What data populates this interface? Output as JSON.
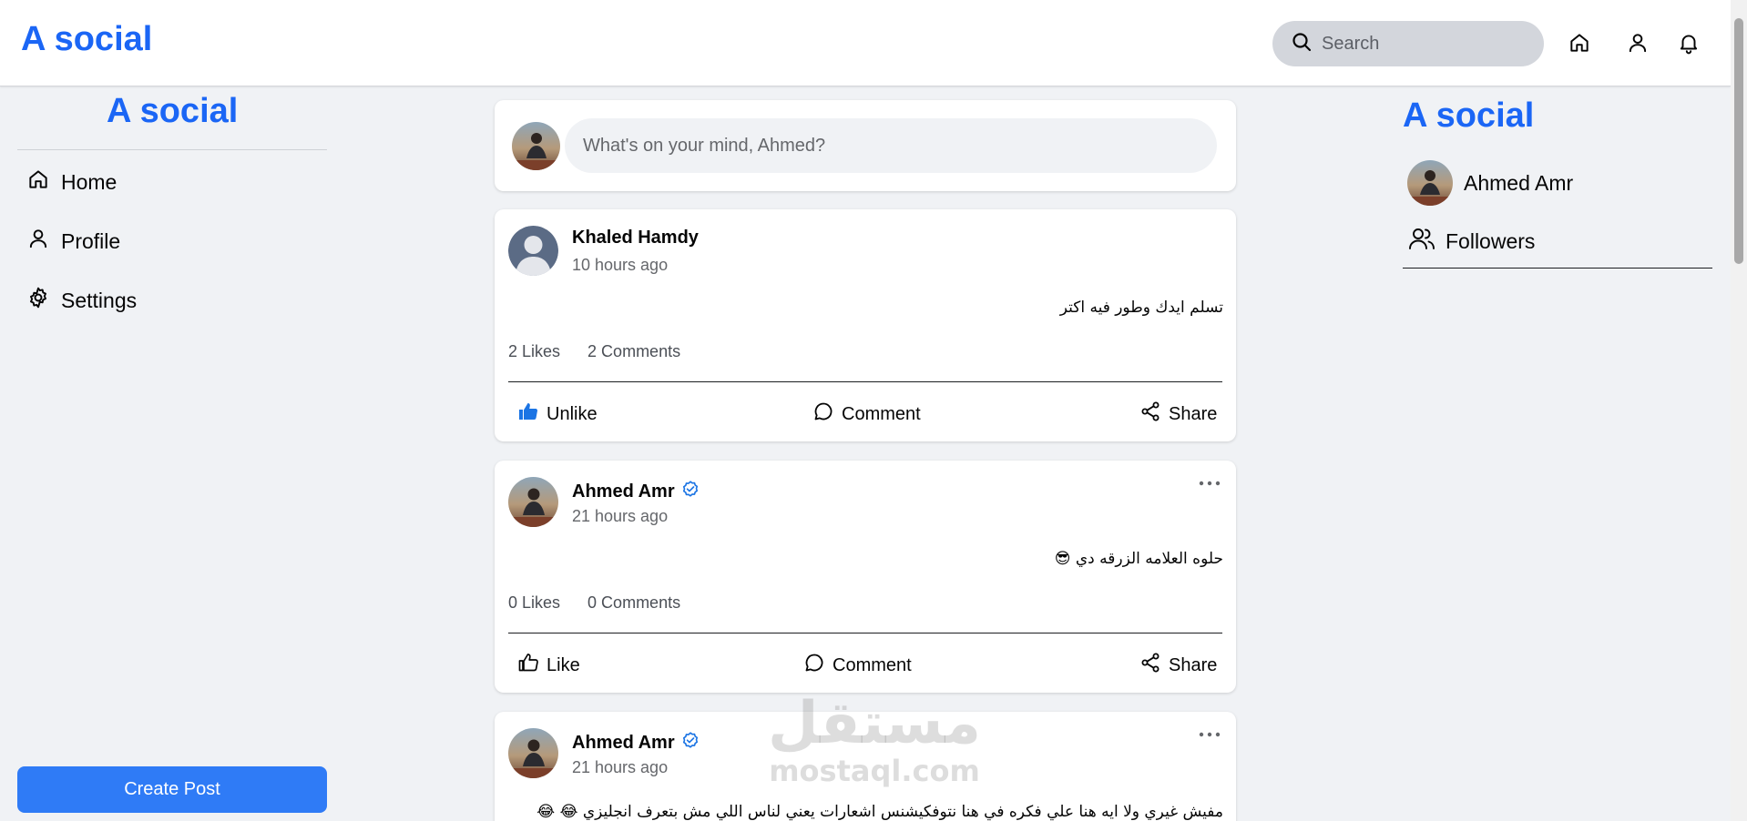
{
  "app": {
    "brand": "A social"
  },
  "header": {
    "search_placeholder": "Search"
  },
  "sidebar": {
    "brand": "A social",
    "items": [
      {
        "label": "Home",
        "icon": "home-icon"
      },
      {
        "label": "Profile",
        "icon": "user-icon"
      },
      {
        "label": "Settings",
        "icon": "gear-icon"
      }
    ],
    "create_post_label": "Create Post"
  },
  "composer": {
    "placeholder": "What's on your mind, Ahmed?"
  },
  "posts": [
    {
      "author": "Khaled Hamdy",
      "verified": false,
      "time": "10 hours ago",
      "text": "تسلم ايدك وطور فيه اكتر",
      "likes": "2 Likes",
      "comments": "2 Comments",
      "like_label": "Unlike",
      "liked": true,
      "comment_label": "Comment",
      "share_label": "Share"
    },
    {
      "author": "Ahmed Amr",
      "verified": true,
      "time": "21 hours ago",
      "text": "حلوه العلامه الزرقه دي 😎",
      "likes": "0 Likes",
      "comments": "0 Comments",
      "like_label": "Like",
      "liked": false,
      "comment_label": "Comment",
      "share_label": "Share"
    },
    {
      "author": "Ahmed Amr",
      "verified": true,
      "time": "21 hours ago",
      "text": "مفيش غيري ولا ايه هنا علي فكره في هنا نتوفكيشنس اشعارات يعني لناس اللي مش بتعرف انجليزي 😂 😂"
    }
  ],
  "right_panel": {
    "brand": "A social",
    "user_name": "Ahmed Amr",
    "followers_label": "Followers"
  },
  "watermark": {
    "arabic": "مستقل",
    "latin": "mostaql.com"
  },
  "colors": {
    "brand": "#1b66f5",
    "button": "#2f7bf6",
    "verified": "#1b74e4",
    "liked": "#1b74e4"
  }
}
